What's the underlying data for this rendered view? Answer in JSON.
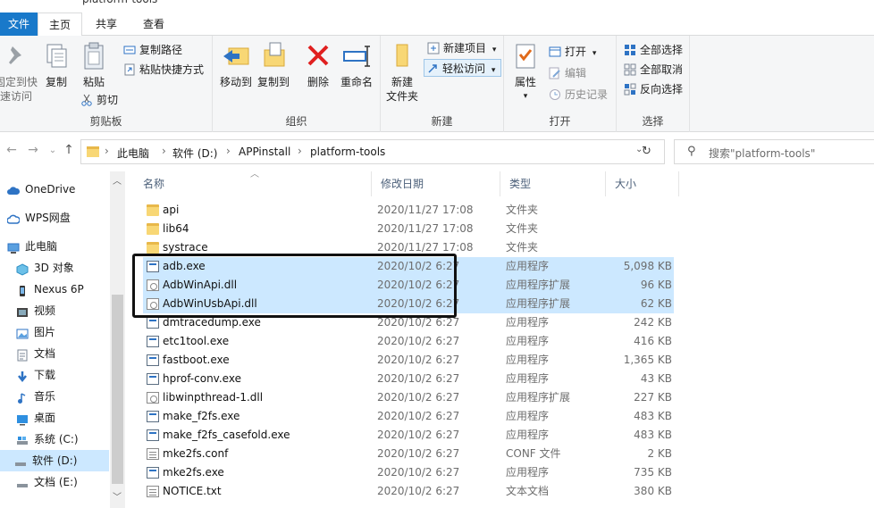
{
  "window": {
    "title": "platform-tools"
  },
  "tabs": [
    {
      "label": "文件"
    },
    {
      "label": "主页"
    },
    {
      "label": "共享"
    },
    {
      "label": "查看"
    }
  ],
  "ribbon": {
    "clipboard": {
      "label": "剪贴板",
      "pin": "固定到快速访问",
      "copy": "复制",
      "paste": "粘贴",
      "copy_path": "复制路径",
      "paste_shortcut": "粘贴快捷方式",
      "cut": "剪切"
    },
    "organize": {
      "label": "组织",
      "move_to": "移动到",
      "copy_to": "复制到",
      "delete": "删除",
      "rename": "重命名"
    },
    "new": {
      "label": "新建",
      "new_folder": "新建\n文件夹",
      "new_item": "新建项目",
      "easy_access": "轻松访问"
    },
    "open": {
      "label": "打开",
      "properties": "属性",
      "open": "打开",
      "edit": "编辑",
      "history": "历史记录"
    },
    "select": {
      "label": "选择",
      "select_all": "全部选择",
      "select_none": "全部取消",
      "invert": "反向选择"
    }
  },
  "address": {
    "crumbs": [
      "此电脑",
      "软件 (D:)",
      "APPinstall",
      "platform-tools"
    ],
    "search_placeholder": "搜索\"platform-tools\""
  },
  "nav_pane": [
    {
      "label": "OneDrive",
      "icon": "cloud-icon"
    },
    {
      "label": "WPS网盘",
      "icon": "cloud-icon"
    },
    {
      "label": "此电脑",
      "icon": "computer-icon"
    },
    {
      "label": "3D 对象",
      "icon": "cube-icon"
    },
    {
      "label": "Nexus 6P",
      "icon": "phone-icon"
    },
    {
      "label": "视频",
      "icon": "video-icon"
    },
    {
      "label": "图片",
      "icon": "picture-icon"
    },
    {
      "label": "文档",
      "icon": "document-icon"
    },
    {
      "label": "下载",
      "icon": "download-icon"
    },
    {
      "label": "音乐",
      "icon": "music-icon"
    },
    {
      "label": "桌面",
      "icon": "desktop-icon"
    },
    {
      "label": "系统 (C:)",
      "icon": "drive-icon"
    },
    {
      "label": "软件 (D:)",
      "icon": "drive-icon"
    },
    {
      "label": "文档 (E:)",
      "icon": "drive-icon"
    }
  ],
  "columns": {
    "name": "名称",
    "date": "修改日期",
    "type": "类型",
    "size": "大小"
  },
  "files": [
    {
      "name": "api",
      "date": "2020/11/27 17:08",
      "type": "文件夹",
      "size": "",
      "kind": "folder",
      "selected": false
    },
    {
      "name": "lib64",
      "date": "2020/11/27 17:08",
      "type": "文件夹",
      "size": "",
      "kind": "folder",
      "selected": false
    },
    {
      "name": "systrace",
      "date": "2020/11/27 17:08",
      "type": "文件夹",
      "size": "",
      "kind": "folder",
      "selected": false
    },
    {
      "name": "adb.exe",
      "date": "2020/10/2 6:27",
      "type": "应用程序",
      "size": "5,098 KB",
      "kind": "exe",
      "selected": true
    },
    {
      "name": "AdbWinApi.dll",
      "date": "2020/10/2 6:27",
      "type": "应用程序扩展",
      "size": "96 KB",
      "kind": "dll",
      "selected": true
    },
    {
      "name": "AdbWinUsbApi.dll",
      "date": "2020/10/2 6:27",
      "type": "应用程序扩展",
      "size": "62 KB",
      "kind": "dll",
      "selected": true
    },
    {
      "name": "dmtracedump.exe",
      "date": "2020/10/2 6:27",
      "type": "应用程序",
      "size": "242 KB",
      "kind": "exe",
      "selected": false
    },
    {
      "name": "etc1tool.exe",
      "date": "2020/10/2 6:27",
      "type": "应用程序",
      "size": "416 KB",
      "kind": "exe",
      "selected": false
    },
    {
      "name": "fastboot.exe",
      "date": "2020/10/2 6:27",
      "type": "应用程序",
      "size": "1,365 KB",
      "kind": "exe",
      "selected": false
    },
    {
      "name": "hprof-conv.exe",
      "date": "2020/10/2 6:27",
      "type": "应用程序",
      "size": "43 KB",
      "kind": "exe",
      "selected": false
    },
    {
      "name": "libwinpthread-1.dll",
      "date": "2020/10/2 6:27",
      "type": "应用程序扩展",
      "size": "227 KB",
      "kind": "dll",
      "selected": false
    },
    {
      "name": "make_f2fs.exe",
      "date": "2020/10/2 6:27",
      "type": "应用程序",
      "size": "483 KB",
      "kind": "exe",
      "selected": false
    },
    {
      "name": "make_f2fs_casefold.exe",
      "date": "2020/10/2 6:27",
      "type": "应用程序",
      "size": "483 KB",
      "kind": "exe",
      "selected": false
    },
    {
      "name": "mke2fs.conf",
      "date": "2020/10/2 6:27",
      "type": "CONF 文件",
      "size": "2 KB",
      "kind": "txt",
      "selected": false
    },
    {
      "name": "mke2fs.exe",
      "date": "2020/10/2 6:27",
      "type": "应用程序",
      "size": "735 KB",
      "kind": "exe",
      "selected": false
    },
    {
      "name": "NOTICE.txt",
      "date": "2020/10/2 6:27",
      "type": "文本文档",
      "size": "380 KB",
      "kind": "txt",
      "selected": false
    }
  ]
}
